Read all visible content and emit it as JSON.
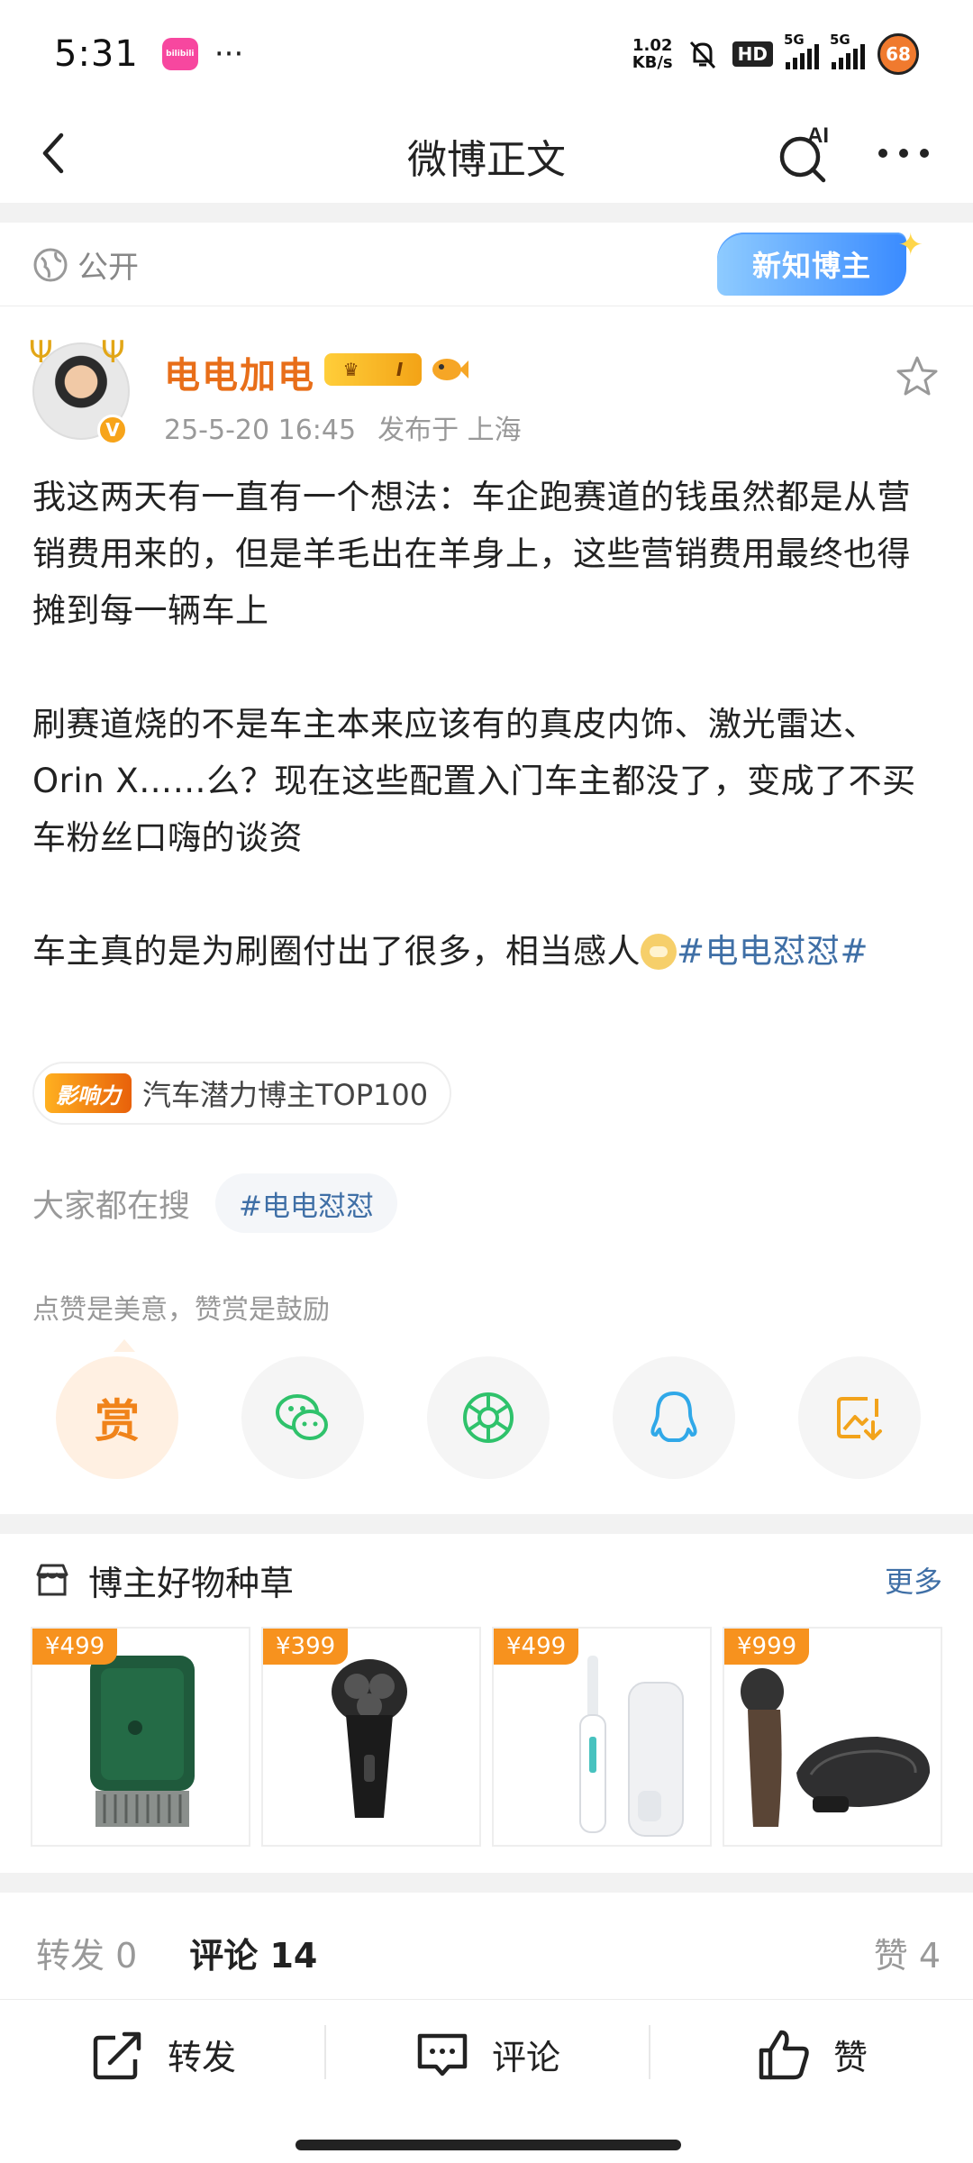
{
  "status_bar": {
    "time": "5:31",
    "app_badge": "bilibili",
    "more": "···",
    "net_speed_value": "1.02",
    "net_speed_unit": "KB/s",
    "hd": "HD",
    "signal_1": "5G",
    "signal_2": "5G",
    "battery": "68"
  },
  "nav": {
    "title": "微博正文",
    "ai_label": "AI"
  },
  "post": {
    "visibility": "公开",
    "new_blogger_badge": "新知博主",
    "author_name": "电电加电",
    "vip_level": "I",
    "timestamp": "25-5-20 16:45",
    "location": "发布于 上海",
    "paragraphs": [
      "我这两天有一直有一个想法：车企跑赛道的钱虽然都是从营销费用来的，但是羊毛出在羊身上，这些营销费用最终也得摊到每一辆车上",
      "刷赛道烧的不是车主本来应该有的真皮内饰、激光雷达、Orin X……么？现在这些配置入门车主都没了，变成了不买车粉丝口嗨的谈资"
    ],
    "last_paragraph_text": "车主真的是为刷圈付出了很多，相当感人",
    "hashtag": "#电电怼怼#",
    "influence_badge": "影响力",
    "influence_text": "汽车潜力博主TOP100",
    "search_label": "大家都在搜",
    "search_tag": "#电电怼怼",
    "appreciation_text": "点赞是美意，赞赏是鼓励",
    "reward_label": "赏"
  },
  "share_buttons": [
    "reward",
    "wechat-icon",
    "moments-icon",
    "qq-icon",
    "save-image-icon"
  ],
  "goods": {
    "title": "博主好物种草",
    "more": "更多",
    "items": [
      {
        "price": "¥499",
        "product": "green-device"
      },
      {
        "price": "¥399",
        "product": "black-shaver"
      },
      {
        "price": "¥499",
        "product": "electric-toothbrush"
      },
      {
        "price": "¥999",
        "product": "shaver-with-case"
      }
    ]
  },
  "stats": {
    "repost": "转发 0",
    "comments": "评论 14",
    "likes": "赞 4"
  },
  "actions": {
    "repost": "转发",
    "comment": "评论",
    "like": "赞"
  },
  "colors": {
    "accent_orange": "#e86e19",
    "link_blue": "#3f6fa6",
    "price_orange": "#f7921e"
  }
}
